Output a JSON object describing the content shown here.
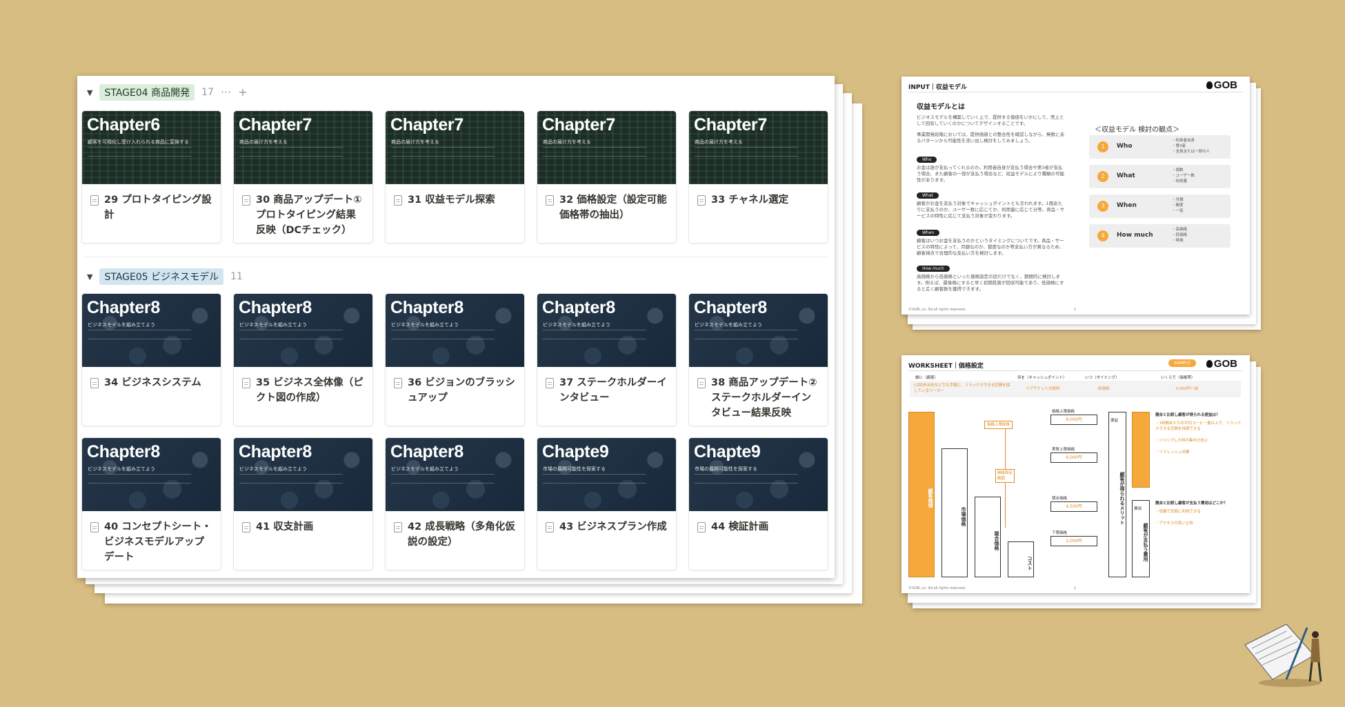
{
  "board": {
    "groups": [
      {
        "tag": "STAGE04 商品開発",
        "count": "17",
        "more": "···",
        "add": "+",
        "cards": [
          {
            "cover_title": "Chapter6",
            "cover_sub": "顧客を可視化し受け入れられる商品に変換する",
            "title": "29 プロトタイピング設計"
          },
          {
            "cover_title": "Chapter7",
            "cover_sub": "商品の届け方を考える",
            "title": "30 商品アップデート①プロトタイピング結果反映（DCチェック）"
          },
          {
            "cover_title": "Chapter7",
            "cover_sub": "商品の届け方を考える",
            "title": "31 収益モデル探索"
          },
          {
            "cover_title": "Chapter7",
            "cover_sub": "商品の届け方を考える",
            "title": "32 価格設定（設定可能価格帯の抽出）"
          },
          {
            "cover_title": "Chapter7",
            "cover_sub": "商品の届け方を考える",
            "title": "33 チャネル選定"
          }
        ]
      },
      {
        "tag": "STAGE05 ビジネスモデル",
        "count": "11",
        "cards": [
          {
            "cover_title": "Chapter8",
            "cover_sub": "ビジネスモデルを組み立てよう",
            "title": "34 ビジネスシステム"
          },
          {
            "cover_title": "Chapter8",
            "cover_sub": "ビジネスモデルを組み立てよう",
            "title": "35 ビジネス全体像（ピクト図の作成）"
          },
          {
            "cover_title": "Chapter8",
            "cover_sub": "ビジネスモデルを組み立てよう",
            "title": "36 ビジョンのブラッシュアップ"
          },
          {
            "cover_title": "Chapter8",
            "cover_sub": "ビジネスモデルを組み立てよう",
            "title": "37 ステークホルダーインタビュー"
          },
          {
            "cover_title": "Chapter8",
            "cover_sub": "ビジネスモデルを組み立てよう",
            "title": "38 商品アップデート②ステークホルダーインタビュー結果反映"
          },
          {
            "cover_title": "Chapter8",
            "cover_sub": "ビジネスモデルを組み立てよう",
            "title": "40 コンセプトシート・ビジネスモデルアップデート"
          },
          {
            "cover_title": "Chapter8",
            "cover_sub": "ビジネスモデルを組み立てよう",
            "title": "41 収支計画"
          },
          {
            "cover_title": "Chapter8",
            "cover_sub": "ビジネスモデルを組み立てよう",
            "title": "42 成長戦略（多角化仮説の設定）"
          },
          {
            "cover_title": "Chapte9",
            "cover_sub": "市場の展開可能性を探索する",
            "title": "43 ビジネスプラン作成"
          },
          {
            "cover_title": "Chapte9",
            "cover_sub": "市場の展開可能性を探索する",
            "title": "44 検証計画"
          }
        ]
      }
    ]
  },
  "input_doc": {
    "header": "INPUT｜収益モデル",
    "logo": "GOB",
    "section_title": "収益モデルとは",
    "intro": "ビジネスモデルを構築していく上で、提供する価値をいかにして、売上として回収していくのかについてデザインすることです。",
    "intro2": "事業開発段階においては、提供価値との整合性を確認しながら、無数にあるパターンから可能性を洗い出し検討をしてみましょう。",
    "items": [
      {
        "pill": "Who",
        "text": "お金は誰が支払ってくれるのか。利用者自身が支払う場合や第3者が支払う場合、また顧客の一部が支払う場合など、収益モデルにより種類の可能性があります。"
      },
      {
        "pill": "What",
        "text": "顧客がお金を支払う対象でキャッシュポイントとも言われます。1個あたりに支払うのか、ユーザー数に応じてか、利用量に応じて分等。商品・サービスの特性に応じて支払う対象が変わります。"
      },
      {
        "pill": "When",
        "text": "顧客はいつお金を支払うのかというタイミングについてです。商品・サービスの特性によって、月額なのか、都度なのか等支払い方が異なるため、顧客視点で合理的な支払い方を検討します。"
      },
      {
        "pill": "How much",
        "text": "高価格から低価格といった価格設定の話だけでなく、期間的に検討します。例えば、最後格にすると早く初期投資が回収可能であり、低価格にすると広く顧客数を獲得できます。"
      }
    ],
    "viewpoints_title": "＜収益モデル 検討の観点＞",
    "viewpoints": [
      {
        "num": "1",
        "label": "Who",
        "details": [
          "・利用者自身",
          "・第3者",
          "・全員または一部の人"
        ]
      },
      {
        "num": "2",
        "label": "What",
        "details": [
          "・個数",
          "・ユーザー数",
          "・利用量"
        ]
      },
      {
        "num": "3",
        "label": "When",
        "details": [
          "・月額",
          "・都度",
          "・一括"
        ]
      },
      {
        "num": "4",
        "label": "How much",
        "details": [
          "・高価格",
          "・低価格",
          "・時価"
        ]
      }
    ],
    "footer": "©GOB.,co. ltd all rights reserved.",
    "page": "1"
  },
  "worksheet_doc": {
    "header": "WORKSHEET｜価格設定",
    "badge": "SAMPLE",
    "logo": "GOB",
    "columns": [
      "誰に（顧客）",
      "何を（キャッシュポイント）",
      "いつ（タイミング）",
      "いくらで（価格帯）"
    ],
    "column_values": [
      "(1回)外出先などでも手軽に、リラックスできる空間を探しているワーカー",
      "ペアチケットの提供",
      "利用時",
      "5,000円～前"
    ],
    "bars": [
      "顧客価値",
      "市場価格",
      "競合価格",
      "コスト"
    ],
    "price_labels": [
      "価格上限価格",
      "実質上限価格",
      "競合価格",
      "下限価格"
    ],
    "prices": [
      "8,000円",
      "6,000円",
      "4,500円",
      "2,000円"
    ],
    "range_label": "価格上限前後",
    "set_label": "価格設定範囲",
    "right_cols": [
      "便益",
      "顧客が得られるメリット",
      "費用",
      "顧客が支払う費用"
    ],
    "notes_title1": "競合と比較し顧客が得られる便益は？",
    "notes1": [
      "・1時間あたりの平均コーヒー量以上で、リラックスできる空間を持続できる",
      "・ジャンプした時の集中力向上",
      "・リフレッシュ効果"
    ],
    "notes_title2": "競合と比較し顧客が支払う費用はどこか？",
    "notes2": [
      "・低額で気軽に利用できる",
      "・アクセスの良い立地"
    ],
    "footer": "©GOB.,co. ltd all rights reserved.",
    "page": "1"
  }
}
